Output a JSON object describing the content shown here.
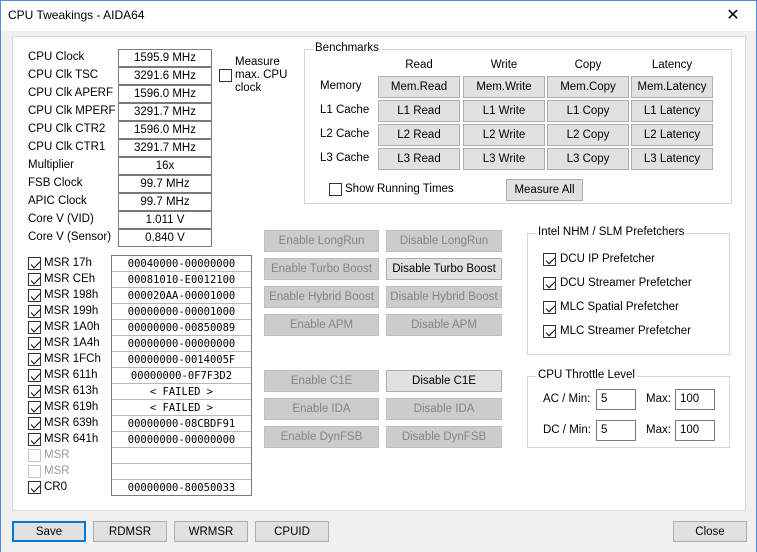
{
  "window": {
    "title": "CPU Tweakings - AIDA64",
    "close_glyph": "✕"
  },
  "cpu_info": [
    {
      "label": "CPU Clock",
      "value": "1595.9 MHz"
    },
    {
      "label": "CPU Clk TSC",
      "value": "3291.6 MHz"
    },
    {
      "label": "CPU Clk APERF",
      "value": "1596.0 MHz"
    },
    {
      "label": "CPU Clk MPERF",
      "value": "3291.7 MHz"
    },
    {
      "label": "CPU Clk CTR2",
      "value": "1596.0 MHz"
    },
    {
      "label": "CPU Clk CTR1",
      "value": "3291.7 MHz"
    },
    {
      "label": "Multiplier",
      "value": "16x"
    },
    {
      "label": "FSB Clock",
      "value": "99.7 MHz"
    },
    {
      "label": "APIC Clock",
      "value": "99.7 MHz"
    },
    {
      "label": "Core V (VID)",
      "value": "1.011 V"
    },
    {
      "label": "Core V (Sensor)",
      "value": "0.840 V"
    }
  ],
  "measure_max": {
    "label_line1": "Measure",
    "label_line2": "max. CPU",
    "label_line3": "clock",
    "checked": false
  },
  "msr": [
    {
      "label": "MSR 17h",
      "value": "00040000-00000000",
      "checked": true,
      "enabled": true
    },
    {
      "label": "MSR CEh",
      "value": "00081010-E0012100",
      "checked": true,
      "enabled": true
    },
    {
      "label": "MSR 198h",
      "value": "000020AA-00001000",
      "checked": true,
      "enabled": true
    },
    {
      "label": "MSR 199h",
      "value": "00000000-00001000",
      "checked": true,
      "enabled": true
    },
    {
      "label": "MSR 1A0h",
      "value": "00000000-00850089",
      "checked": true,
      "enabled": true
    },
    {
      "label": "MSR 1A4h",
      "value": "00000000-00000000",
      "checked": true,
      "enabled": true
    },
    {
      "label": "MSR 1FCh",
      "value": "00000000-0014005F",
      "checked": true,
      "enabled": true
    },
    {
      "label": "MSR 611h",
      "value": "00000000-0F7F3D2",
      "checked": true,
      "enabled": true
    },
    {
      "label": "MSR 613h",
      "value": "< FAILED >",
      "checked": true,
      "enabled": true
    },
    {
      "label": "MSR 619h",
      "value": "< FAILED >",
      "checked": true,
      "enabled": true
    },
    {
      "label": "MSR 639h",
      "value": "00000000-08CBDF91",
      "checked": true,
      "enabled": true
    },
    {
      "label": "MSR 641h",
      "value": "00000000-00000000",
      "checked": true,
      "enabled": true
    },
    {
      "label": "MSR",
      "value": "",
      "checked": false,
      "enabled": false
    },
    {
      "label": "MSR",
      "value": "",
      "checked": false,
      "enabled": false
    },
    {
      "label": "CR0",
      "value": "00000000-80050033",
      "checked": true,
      "enabled": true
    }
  ],
  "benchmarks": {
    "title": "Benchmarks",
    "columns": [
      "Read",
      "Write",
      "Copy",
      "Latency"
    ],
    "rows": [
      {
        "label": "Memory",
        "buttons": [
          "Mem.Read",
          "Mem.Write",
          "Mem.Copy",
          "Mem.Latency"
        ]
      },
      {
        "label": "L1 Cache",
        "buttons": [
          "L1 Read",
          "L1 Write",
          "L1 Copy",
          "L1 Latency"
        ]
      },
      {
        "label": "L2 Cache",
        "buttons": [
          "L2 Read",
          "L2 Write",
          "L2 Copy",
          "L2 Latency"
        ]
      },
      {
        "label": "L3 Cache",
        "buttons": [
          "L3 Read",
          "L3 Write",
          "L3 Copy",
          "L3 Latency"
        ]
      }
    ],
    "show_running_times": "Show Running Times",
    "measure_all": "Measure All"
  },
  "feature_buttons": [
    {
      "enable": "Enable LongRun",
      "disable": "Disable LongRun",
      "enable_on": false,
      "disable_on": false
    },
    {
      "enable": "Enable Turbo Boost",
      "disable": "Disable Turbo Boost",
      "enable_on": false,
      "disable_on": true
    },
    {
      "enable": "Enable Hybrid Boost",
      "disable": "Disable Hybrid Boost",
      "enable_on": false,
      "disable_on": false
    },
    {
      "enable": "Enable APM",
      "disable": "Disable APM",
      "enable_on": false,
      "disable_on": false
    },
    {
      "enable": "Enable C1E",
      "disable": "Disable C1E",
      "enable_on": false,
      "disable_on": true
    },
    {
      "enable": "Enable IDA",
      "disable": "Disable IDA",
      "enable_on": false,
      "disable_on": false
    },
    {
      "enable": "Enable DynFSB",
      "disable": "Disable DynFSB",
      "enable_on": false,
      "disable_on": false
    }
  ],
  "prefetchers": {
    "title": "Intel NHM / SLM Prefetchers",
    "items": [
      {
        "label": "DCU IP Prefetcher",
        "checked": true
      },
      {
        "label": "DCU Streamer Prefetcher",
        "checked": true
      },
      {
        "label": "MLC Spatial Prefetcher",
        "checked": true
      },
      {
        "label": "MLC Streamer Prefetcher",
        "checked": true
      }
    ]
  },
  "throttle": {
    "title": "CPU Throttle Level",
    "ac_label": "AC / Min:",
    "ac_min": "5",
    "ac_max_label": "Max:",
    "ac_max": "100",
    "dc_label": "DC / Min:",
    "dc_min": "5",
    "dc_max_label": "Max:",
    "dc_max": "100"
  },
  "footer": {
    "save": "Save",
    "rdmsr": "RDMSR",
    "wrmsr": "WRMSR",
    "cpuid": "CPUID",
    "close": "Close"
  }
}
